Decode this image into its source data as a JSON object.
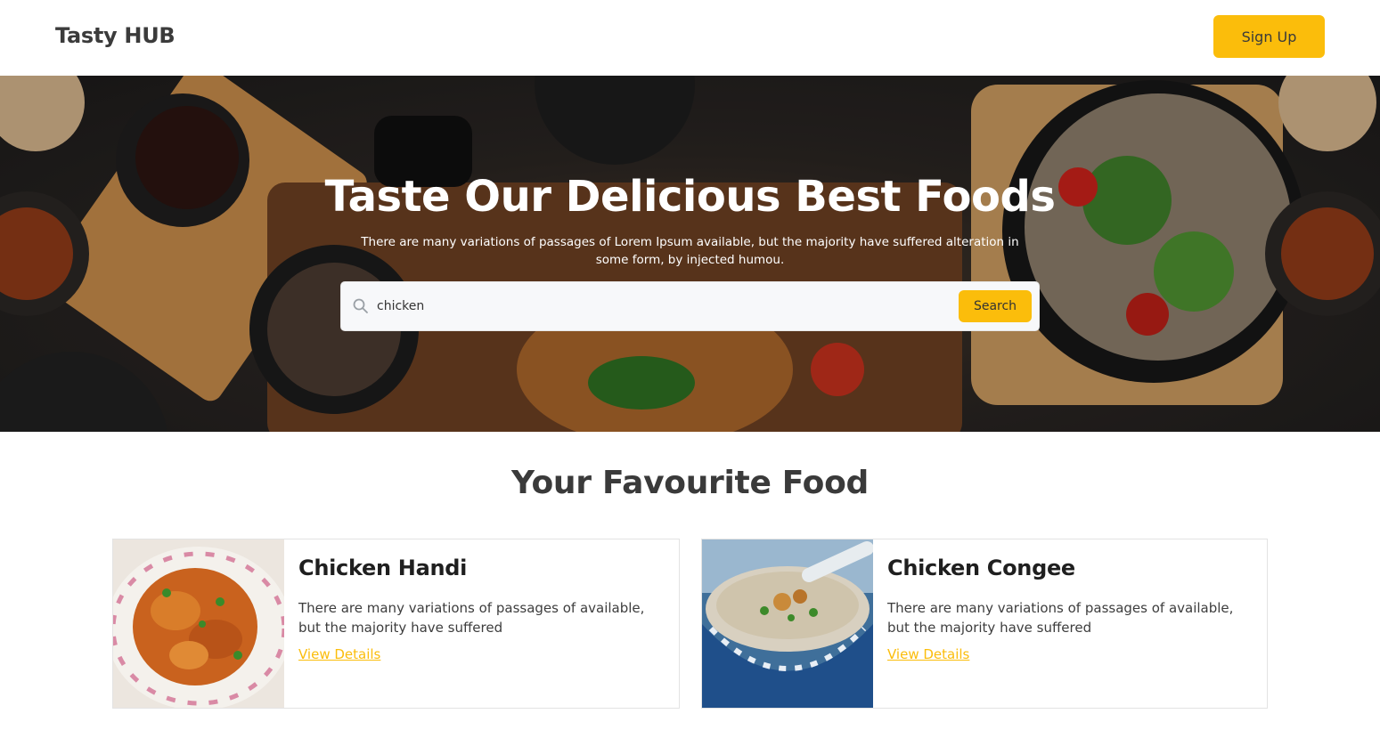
{
  "header": {
    "brand": "Tasty HUB",
    "signup_label": "Sign Up"
  },
  "hero": {
    "title": "Taste Our Delicious Best Foods",
    "subtitle": "There are many variations of passages of Lorem Ipsum available, but the majority have suffered alteration in some form, by injected humou.",
    "search": {
      "value": "chicken",
      "button_label": "Search",
      "icon": "search-icon"
    }
  },
  "section": {
    "title": "Your Favourite Food"
  },
  "cards": [
    {
      "title": "Chicken Handi",
      "description": "There are many variations of passages of available, but the majority have suffered",
      "link_label": "View Details"
    },
    {
      "title": "Chicken Congee",
      "description": "There are many variations of passages of available, but the majority have suffered",
      "link_label": "View Details"
    }
  ],
  "colors": {
    "accent": "#fbbd0b",
    "text": "#3a3a3a"
  }
}
